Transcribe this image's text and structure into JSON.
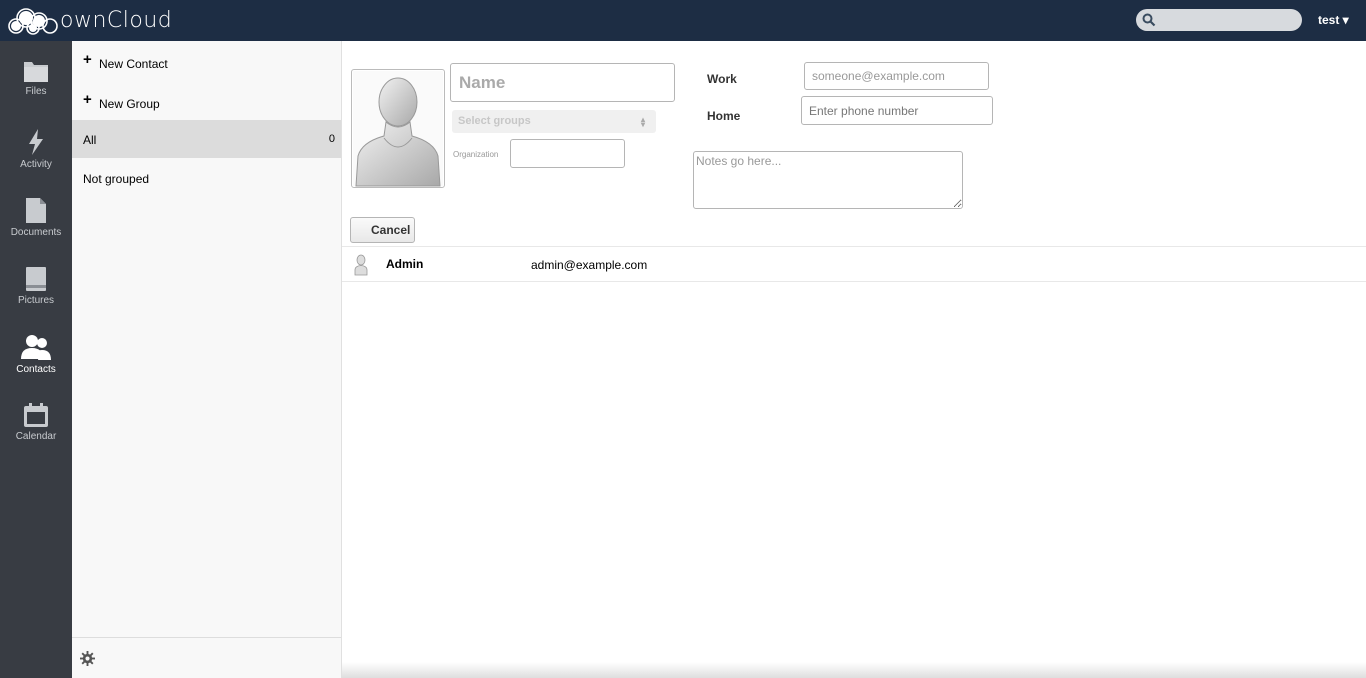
{
  "header": {
    "logo_text": "ownCloud",
    "search_placeholder": "",
    "user": "test ▾",
    "background": "#1d2d44"
  },
  "apps": [
    {
      "label": "Files",
      "icon": "folder-icon"
    },
    {
      "label": "Activity",
      "icon": "lightning-icon"
    },
    {
      "label": "Documents",
      "icon": "document-icon"
    },
    {
      "label": "Pictures",
      "icon": "picture-icon"
    },
    {
      "label": "Contacts",
      "icon": "contacts-icon",
      "active": true
    },
    {
      "label": "Calendar",
      "icon": "calendar-icon"
    }
  ],
  "sidebar": {
    "new_contact": "New Contact",
    "new_group": "New Group",
    "groups": [
      {
        "label": "All",
        "count": "0",
        "active": true
      },
      {
        "label": "Not grouped",
        "count": ""
      }
    ]
  },
  "editor": {
    "name_placeholder": "Name",
    "groups_placeholder": "Select groups",
    "organization_label": "Organization",
    "email_type": "Work",
    "email_placeholder": "someone@example.com",
    "phone_type": "Home",
    "phone_placeholder": "Enter phone number",
    "notes_placeholder": "Notes go here...",
    "cancel": "Cancel"
  },
  "contacts": [
    {
      "name": "Admin",
      "email": "admin@example.com"
    }
  ]
}
